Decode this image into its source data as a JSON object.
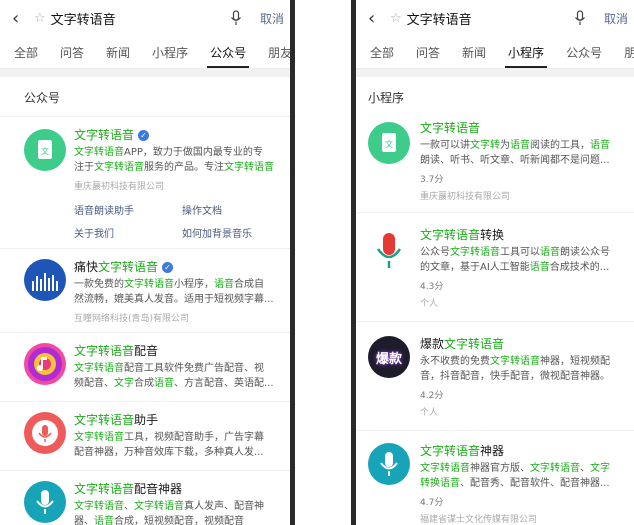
{
  "left": {
    "search": {
      "query": "文字转语音",
      "cancel": "取消"
    },
    "tabs": [
      "全部",
      "问答",
      "新闻",
      "小程序",
      "公众号",
      "朋友"
    ],
    "section_title": "公众号",
    "results": [
      {
        "title_parts": [
          {
            "t": "文字转语音",
            "hl": true
          }
        ],
        "verified": true,
        "desc_lines": [
          [
            {
              "t": "文字转语音",
              "hl": true
            },
            {
              "t": "APP，致力于做国内最专业的专"
            }
          ],
          [
            {
              "t": "注于"
            },
            {
              "t": "文字转语音",
              "hl": true
            },
            {
              "t": "服务的产品。专注"
            },
            {
              "t": "文字转语音",
              "hl": true
            }
          ]
        ],
        "meta": "重庆蕞初科技有限公司",
        "links": [
          "语音朗读助手",
          "操作文档",
          "关于我们",
          "如何加背景音乐"
        ]
      },
      {
        "title_parts": [
          {
            "t": "痛快"
          },
          {
            "t": "文字转语音",
            "hl": true
          }
        ],
        "verified": true,
        "desc_lines": [
          [
            {
              "t": "一款免费的"
            },
            {
              "t": "文字转语音",
              "hl": true
            },
            {
              "t": "小程序，"
            },
            {
              "t": "语音",
              "hl": true
            },
            {
              "t": "合成自"
            }
          ],
          [
            {
              "t": "然流畅，媲美真人发音。适用于短视频字幕..."
            }
          ]
        ],
        "meta": "互瞳网络科技(青岛)有限公司"
      },
      {
        "title_parts": [
          {
            "t": "文字转语音",
            "hl": true
          },
          {
            "t": "配音"
          }
        ],
        "desc_lines": [
          [
            {
              "t": "文字转语音",
              "hl": true
            },
            {
              "t": "配音工具软件免费广告配音、视"
            }
          ],
          [
            {
              "t": "频配音、"
            },
            {
              "t": "文字",
              "hl": true
            },
            {
              "t": "合成"
            },
            {
              "t": "语音",
              "hl": true
            },
            {
              "t": "、方言配音、英语配..."
            }
          ]
        ]
      },
      {
        "title_parts": [
          {
            "t": "文字转语音",
            "hl": true
          },
          {
            "t": "助手"
          }
        ],
        "desc_lines": [
          [
            {
              "t": "文字转语音",
              "hl": true
            },
            {
              "t": "工具，视频配音助手，广告字幕"
            }
          ],
          [
            {
              "t": "配音神器，万种音效库下载，多种真人发..."
            }
          ]
        ]
      },
      {
        "title_parts": [
          {
            "t": "文字转语音",
            "hl": true
          },
          {
            "t": "配音神器"
          }
        ],
        "desc_lines": [
          [
            {
              "t": "文字转语音",
              "hl": true
            },
            {
              "t": "、"
            },
            {
              "t": "文字转语音",
              "hl": true
            },
            {
              "t": "真人发声、配音神"
            }
          ],
          [
            {
              "t": "器、"
            },
            {
              "t": "语音",
              "hl": true
            },
            {
              "t": "合成，短视频配音，视频配音"
            }
          ]
        ]
      }
    ]
  },
  "right": {
    "search": {
      "query": "文字转语音",
      "cancel": "取消"
    },
    "tabs": [
      "全部",
      "问答",
      "新闻",
      "小程序",
      "公众号",
      "朋友"
    ],
    "section_title": "小程序",
    "results": [
      {
        "title_parts": [
          {
            "t": "文字转语音",
            "hl": true
          }
        ],
        "desc_lines": [
          [
            {
              "t": "一款可以讲"
            },
            {
              "t": "文字转",
              "hl": true
            },
            {
              "t": "为"
            },
            {
              "t": "语音",
              "hl": true
            },
            {
              "t": "阅读的工具，"
            },
            {
              "t": "语音",
              "hl": true
            }
          ],
          [
            {
              "t": "朗读、听书、听文章、听新闻都不是问题..."
            }
          ]
        ],
        "rating": "3.7分",
        "meta": "重庆蕞初科技有限公司"
      },
      {
        "title_parts": [
          {
            "t": "文字转语音",
            "hl": true
          },
          {
            "t": "转换"
          }
        ],
        "desc_lines": [
          [
            {
              "t": "公众号"
            },
            {
              "t": "文字转语音",
              "hl": true
            },
            {
              "t": "工具可以"
            },
            {
              "t": "语音",
              "hl": true
            },
            {
              "t": "朗读公众号"
            }
          ],
          [
            {
              "t": "的文章，基于AI人工智能"
            },
            {
              "t": "语音",
              "hl": true
            },
            {
              "t": "合成技术的..."
            }
          ]
        ],
        "rating": "4.3分",
        "meta": "个人"
      },
      {
        "title_parts": [
          {
            "t": "爆款"
          },
          {
            "t": "文字转语音",
            "hl": true
          }
        ],
        "avatar_text": "爆款",
        "desc_lines": [
          [
            {
              "t": "永不收费的免费"
            },
            {
              "t": "文字转语音",
              "hl": true
            },
            {
              "t": "神器，短视频配"
            }
          ],
          [
            {
              "t": "音，抖音配音，快手配音，微视配音神器。"
            }
          ]
        ],
        "rating": "4.2分",
        "meta": "个人"
      },
      {
        "title_parts": [
          {
            "t": "文字转语音",
            "hl": true
          },
          {
            "t": "神器"
          }
        ],
        "desc_lines": [
          [
            {
              "t": "文字转语音",
              "hl": true
            },
            {
              "t": "神器官方版、"
            },
            {
              "t": "文字转语音",
              "hl": true
            },
            {
              "t": "、"
            },
            {
              "t": "文字",
              "hl": true
            }
          ],
          [
            {
              "t": "转换语音",
              "hl": true
            },
            {
              "t": "、配音秀、配音软件、配音神器..."
            }
          ]
        ],
        "rating": "4.7分",
        "meta": "福建省谋士文化传媒有限公司"
      }
    ]
  },
  "colors": {
    "highlight": "#1aad19",
    "link": "#4a5a80",
    "verified": "#3b7bdf"
  }
}
